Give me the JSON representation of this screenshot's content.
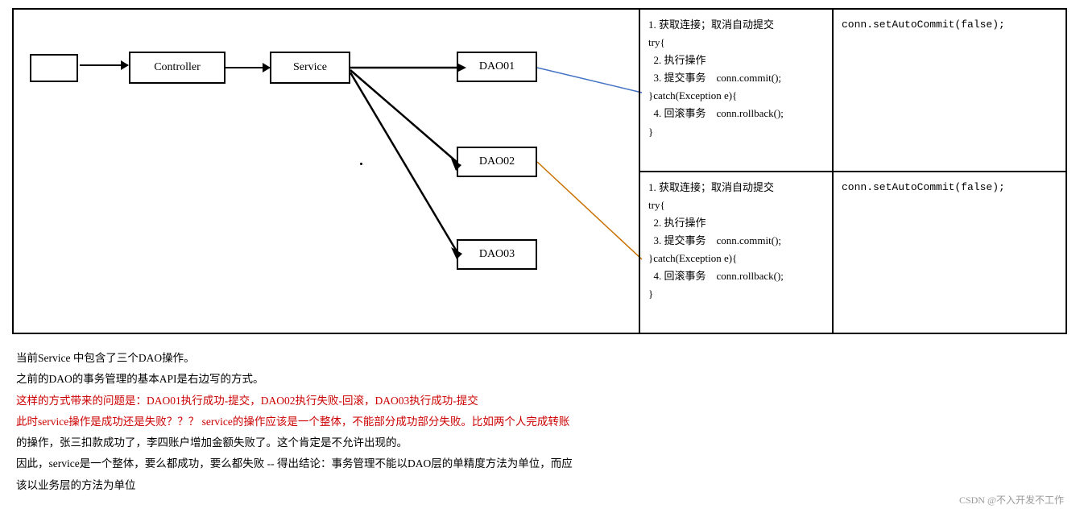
{
  "diagram": {
    "input_box_label": "",
    "controller_label": "Controller",
    "service_label": "Service",
    "dao01_label": "DAO01",
    "dao02_label": "DAO02",
    "dao03_label": "DAO03"
  },
  "tx_blocks": [
    {
      "left_lines": [
        "1. 获取连接；取消自动提交",
        "try{",
        "  2. 执行操作",
        "  3. 提交事务    conn.commit();",
        "}catch(Exception e){",
        "  4. 回滚事务    conn.rollback();",
        "}"
      ],
      "right_code": "conn.setAutoCommit(false);"
    },
    {
      "left_lines": [
        "1. 获取连接；取消自动提交",
        "try{",
        "  2. 执行操作",
        "  3. 提交事务    conn.commit();",
        "}catch(Exception e){",
        "  4. 回滚事务    conn.rollback();",
        "}"
      ],
      "right_code": "conn.setAutoCommit(false);"
    }
  ],
  "bottom_paragraphs": [
    "当前Service 中包含了三个DAO操作。",
    "之前的DAO的事务管理的基本API是右边写的方式。",
    "这样的方式带来的问题是：DAO01执行成功-提交，DAO02执行失败-回滚，DAO03执行成功-提交",
    "此时service操作是成功还是失败？？？  service的操作应该是一个整体，不能部分成功部分失败。比如两个人完成转账",
    "的操作，张三扣款成功了，李四账户增加金额失败了。这个肯定是不允许出现的。",
    "因此，service是一个整体，要么都成功，要么都失败 -- 得出结论：事务管理不能以DAO层的单精度方法为单位，而应",
    "该以业务层的方法为单位"
  ],
  "watermark": "CSDN @不入开发不工作"
}
